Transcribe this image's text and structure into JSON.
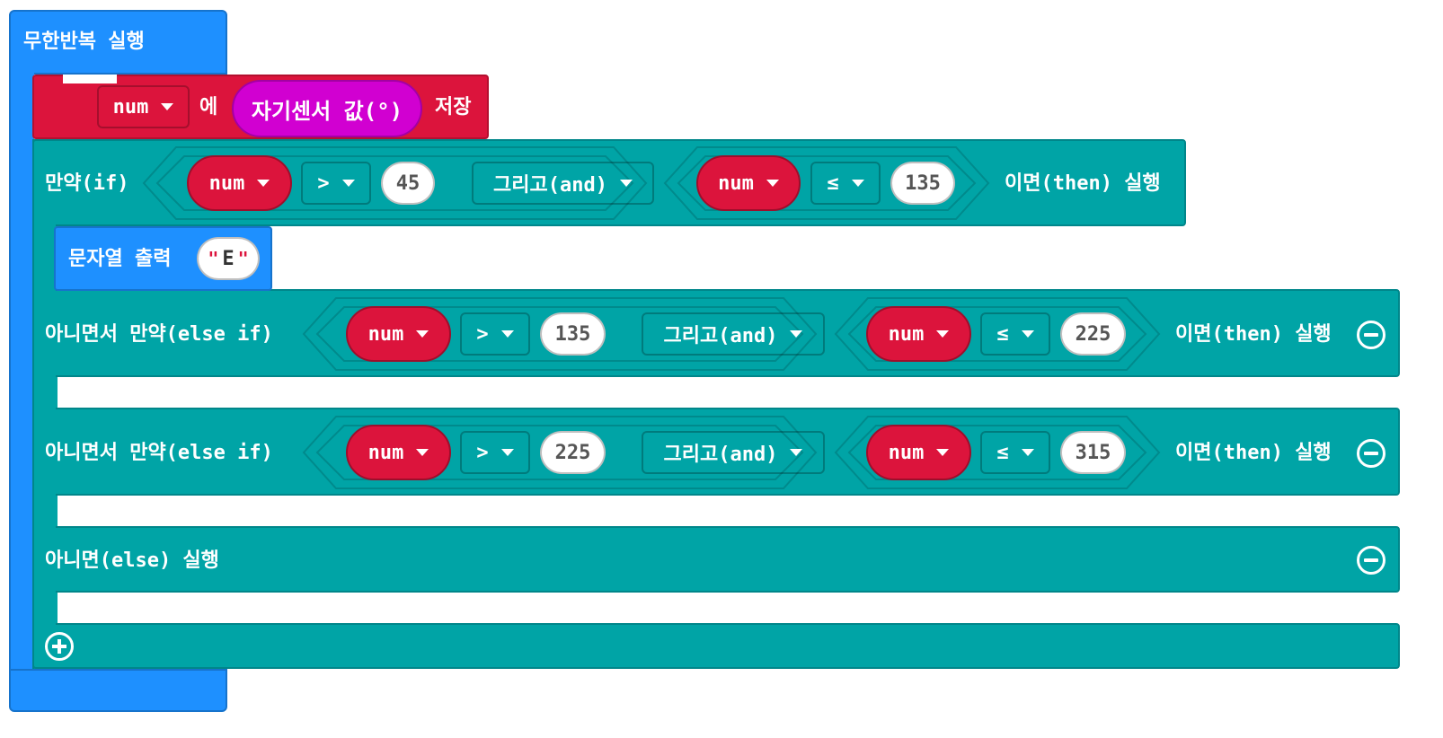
{
  "forever": {
    "label": "무한반복 실행"
  },
  "set_block": {
    "variable": "num",
    "connector": "에",
    "value_block": "자기센서 값(°)",
    "action": "저장"
  },
  "if_block": {
    "rows": [
      {
        "prefix": "만약(if)",
        "left": {
          "var": "num",
          "op": ">",
          "value": "45"
        },
        "logic": "그리고(and)",
        "right": {
          "var": "num",
          "op": "≤",
          "value": "135"
        },
        "suffix": "이면(then) 실행"
      },
      {
        "prefix": "아니면서 만약(else if)",
        "left": {
          "var": "num",
          "op": ">",
          "value": "135"
        },
        "logic": "그리고(and)",
        "right": {
          "var": "num",
          "op": "≤",
          "value": "225"
        },
        "suffix": "이면(then) 실행"
      },
      {
        "prefix": "아니면서 만약(else if)",
        "left": {
          "var": "num",
          "op": ">",
          "value": "225"
        },
        "logic": "그리고(and)",
        "right": {
          "var": "num",
          "op": "≤",
          "value": "315"
        },
        "suffix": "이면(then) 실행"
      }
    ],
    "else_label": "아니면(else) 실행"
  },
  "show_string": {
    "label": "문자열 출력",
    "value": "E"
  },
  "icons": {
    "remove": "minus-circle-icon",
    "add": "plus-circle-icon",
    "dropdown": "caret-down-icon"
  },
  "colors": {
    "loops": "#1E90FF",
    "variables": "#DC143C",
    "logic": "#00A4A6",
    "input": "#D100D1"
  }
}
